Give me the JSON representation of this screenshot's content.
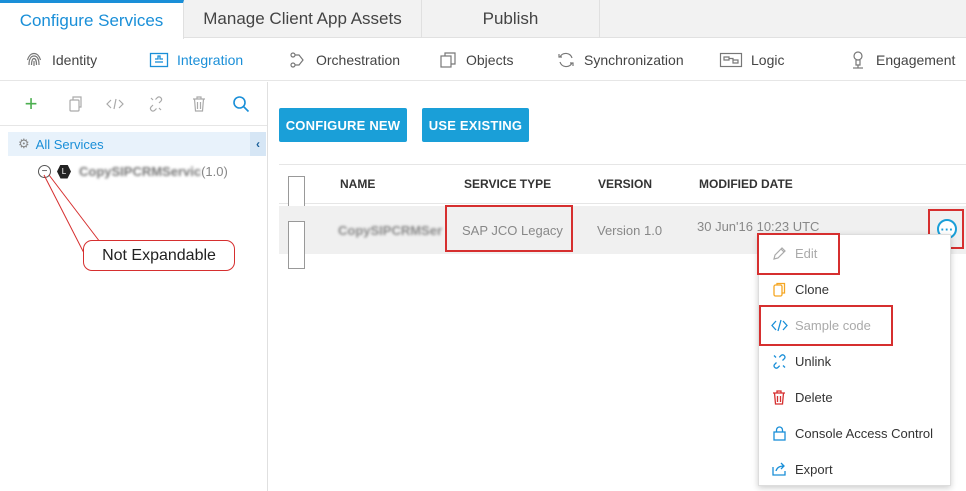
{
  "top_tabs": [
    {
      "label": "Configure Services",
      "active": true
    },
    {
      "label": "Manage Client App Assets",
      "active": false
    },
    {
      "label": "Publish",
      "active": false
    }
  ],
  "sub_nav": [
    {
      "label": "Identity",
      "icon": "fingerprint-icon"
    },
    {
      "label": "Integration",
      "icon": "integration-icon",
      "active": true
    },
    {
      "label": "Orchestration",
      "icon": "orchestration-icon"
    },
    {
      "label": "Objects",
      "icon": "objects-icon"
    },
    {
      "label": "Synchronization",
      "icon": "sync-icon"
    },
    {
      "label": "Logic",
      "icon": "logic-icon"
    },
    {
      "label": "Engagement",
      "icon": "engagement-icon"
    }
  ],
  "left_panel": {
    "toolbar_icons": [
      "plus-icon",
      "copy-icon",
      "code-icon",
      "unlink-icon",
      "trash-icon",
      "search-icon"
    ],
    "all_services_label": "All Services",
    "tree_node": {
      "name": "CopySIPCRMServic",
      "version": "(1.0)",
      "badge": "L"
    },
    "callout": "Not Expandable"
  },
  "main": {
    "configure_new": "CONFIGURE NEW",
    "use_existing": "USE EXISTING",
    "columns": [
      "NAME",
      "SERVICE TYPE",
      "VERSION",
      "MODIFIED DATE"
    ],
    "row": {
      "name": "CopySIPCRMSer",
      "service_type": "SAP JCO Legacy",
      "version": "Version 1.0",
      "modified": "30 Jun'16 10:23 UTC"
    }
  },
  "menu": [
    {
      "label": "Edit",
      "icon": "pencil-icon",
      "disabled": true
    },
    {
      "label": "Clone",
      "icon": "clone-icon",
      "disabled": false
    },
    {
      "label": "Sample code",
      "icon": "code-icon",
      "disabled": true
    },
    {
      "label": "Unlink",
      "icon": "unlink-icon",
      "disabled": false
    },
    {
      "label": "Delete",
      "icon": "trash-icon",
      "disabled": false
    },
    {
      "label": "Console Access Control",
      "icon": "lock-icon",
      "disabled": false
    },
    {
      "label": "Export",
      "icon": "export-icon",
      "disabled": false
    }
  ],
  "colors": {
    "accent": "#1a8fd8",
    "button": "#1a9fd8",
    "highlight_red": "#d62f2f"
  }
}
